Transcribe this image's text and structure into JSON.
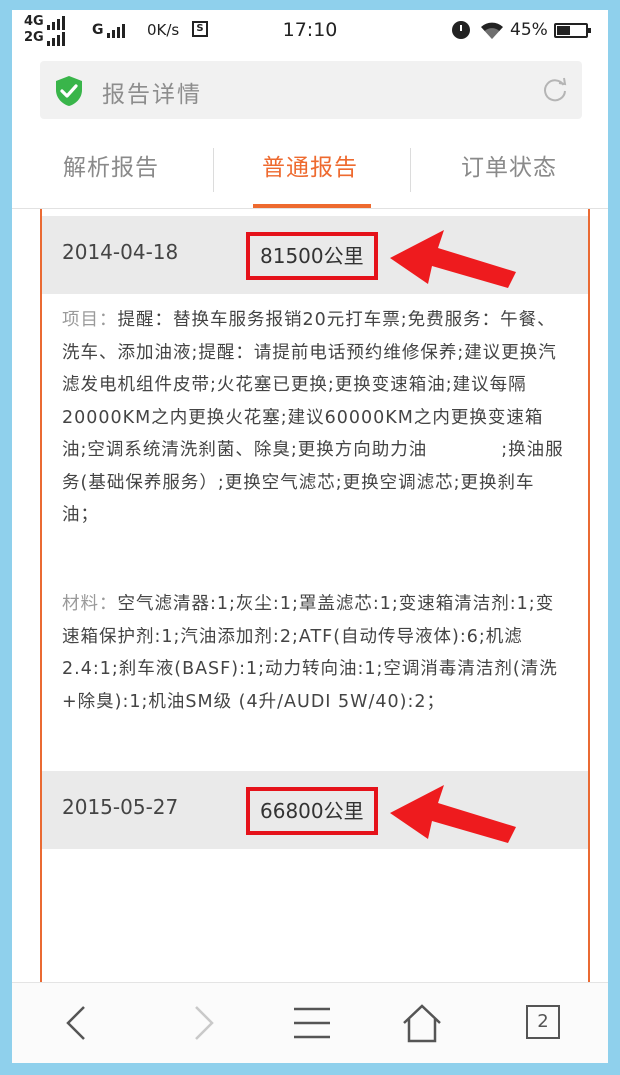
{
  "status_bar": {
    "network_top": "4G",
    "network_bottom": "2G",
    "network_g": "G",
    "speed": "0K/s",
    "s_icon": "S",
    "time": "17:10",
    "battery": "45%"
  },
  "address_bar": {
    "title": "报告详情",
    "icons": [
      "shield-check-icon",
      "reload-icon"
    ],
    "accent": "#39b54a"
  },
  "tabs": [
    {
      "label": "解析报告",
      "active": false
    },
    {
      "label": "普通报告",
      "active": true
    },
    {
      "label": "订单状态",
      "active": false
    }
  ],
  "records": [
    {
      "date": "2014-04-18",
      "mileage": "81500公里",
      "items_label": "项目：",
      "items_text": "提醒：替换车服务报销20元打车票;免费服务：午餐、洗车、添加油液;提醒：请提前电话预约维修保养;建议更换汽滤发电机组件皮带;火花塞已更换;更换变速箱油;建议每隔20000KM之内更换火花塞;建议60000KM之内更换变速箱油;空调系统清洗刹菌、除臭;更换方向助力油　　　　;换油服务(基础保养服务）;更换空气滤芯;更换空调滤芯;更换刹车油；",
      "materials_label": "材料：",
      "materials_text": "空气滤清器:1;灰尘:1;罩盖滤芯:1;变速箱清洁剂:1;变速箱保护剂:1;汽油添加剂:2;ATF(自动传导液体):6;机滤2.4:1;刹车液(BASF):1;动力转向油:1;空调消毒清洁剂(清洗+除臭):1;机油SM级 (4升/AUDI 5W/40):2；"
    },
    {
      "date": "2015-05-27",
      "mileage": "66800公里"
    }
  ],
  "colors": {
    "accent_orange": "#ee6a2f",
    "highlight_red": "#e5121a",
    "background": "#8fd0ec"
  },
  "nav_bar": {
    "tab_count": "2",
    "icons": [
      "back-icon",
      "forward-icon",
      "menu-icon",
      "home-icon",
      "tabs-icon"
    ]
  }
}
